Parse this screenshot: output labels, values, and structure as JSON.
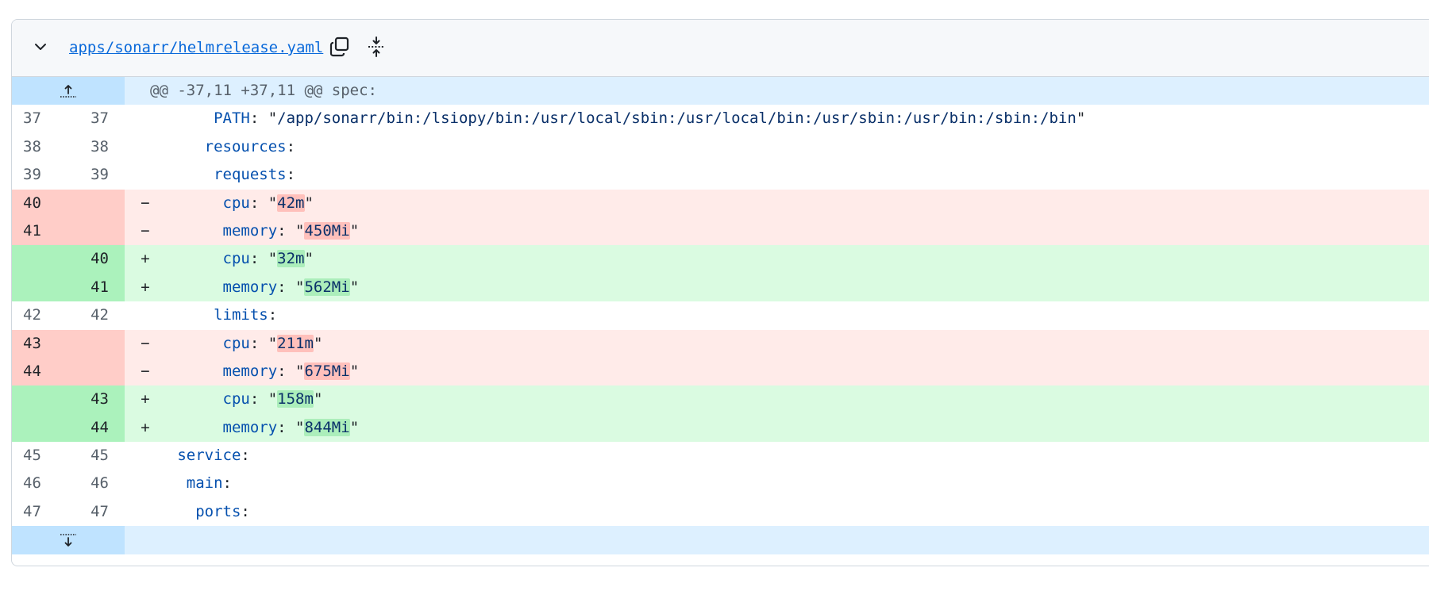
{
  "file": {
    "path": "apps/sonarr/helmrelease.yaml"
  },
  "icons": {
    "collapse": "chevron-down-icon",
    "copy": "copy-icon",
    "expand_all": "expand-all-icon",
    "expand_up": "expand-up-icon",
    "expand_down": "expand-down-icon"
  },
  "hunk_header": "@@ -37,11 +37,11 @@ spec:",
  "lines": [
    {
      "type": "ctx",
      "old": "37",
      "new": "37",
      "marker": "",
      "indent": "       ",
      "key": "PATH",
      "sep": ": \"",
      "val": "/app/sonarr/bin:/lsiopy/bin:/usr/local/sbin:/usr/local/bin:/usr/sbin:/usr/bin:/sbin:/bin",
      "end": "\""
    },
    {
      "type": "ctx",
      "old": "38",
      "new": "38",
      "marker": "",
      "indent": "      ",
      "key": "resources",
      "sep": ":",
      "val": "",
      "end": ""
    },
    {
      "type": "ctx",
      "old": "39",
      "new": "39",
      "marker": "",
      "indent": "       ",
      "key": "requests",
      "sep": ":",
      "val": "",
      "end": ""
    },
    {
      "type": "del",
      "old": "40",
      "new": "",
      "marker": "−",
      "indent": "        ",
      "key": "cpu",
      "sep": ": \"",
      "val": "42m",
      "end": "\""
    },
    {
      "type": "del",
      "old": "41",
      "new": "",
      "marker": "−",
      "indent": "        ",
      "key": "memory",
      "sep": ": \"",
      "val": "450Mi",
      "end": "\""
    },
    {
      "type": "add",
      "old": "",
      "new": "40",
      "marker": "+",
      "indent": "        ",
      "key": "cpu",
      "sep": ": \"",
      "val": "32m",
      "end": "\""
    },
    {
      "type": "add",
      "old": "",
      "new": "41",
      "marker": "+",
      "indent": "        ",
      "key": "memory",
      "sep": ": \"",
      "val": "562Mi",
      "end": "\""
    },
    {
      "type": "ctx",
      "old": "42",
      "new": "42",
      "marker": "",
      "indent": "       ",
      "key": "limits",
      "sep": ":",
      "val": "",
      "end": ""
    },
    {
      "type": "del",
      "old": "43",
      "new": "",
      "marker": "−",
      "indent": "        ",
      "key": "cpu",
      "sep": ": \"",
      "val": "211m",
      "end": "\""
    },
    {
      "type": "del",
      "old": "44",
      "new": "",
      "marker": "−",
      "indent": "        ",
      "key": "memory",
      "sep": ": \"",
      "val": "675Mi",
      "end": "\""
    },
    {
      "type": "add",
      "old": "",
      "new": "43",
      "marker": "+",
      "indent": "        ",
      "key": "cpu",
      "sep": ": \"",
      "val": "158m",
      "end": "\""
    },
    {
      "type": "add",
      "old": "",
      "new": "44",
      "marker": "+",
      "indent": "        ",
      "key": "memory",
      "sep": ": \"",
      "val": "844Mi",
      "end": "\""
    },
    {
      "type": "ctx",
      "old": "45",
      "new": "45",
      "marker": "",
      "indent": "   ",
      "key": "service",
      "sep": ":",
      "val": "",
      "end": ""
    },
    {
      "type": "ctx",
      "old": "46",
      "new": "46",
      "marker": "",
      "indent": "    ",
      "key": "main",
      "sep": ":",
      "val": "",
      "end": ""
    },
    {
      "type": "ctx",
      "old": "47",
      "new": "47",
      "marker": "",
      "indent": "     ",
      "key": "ports",
      "sep": ":",
      "val": "",
      "end": ""
    }
  ]
}
